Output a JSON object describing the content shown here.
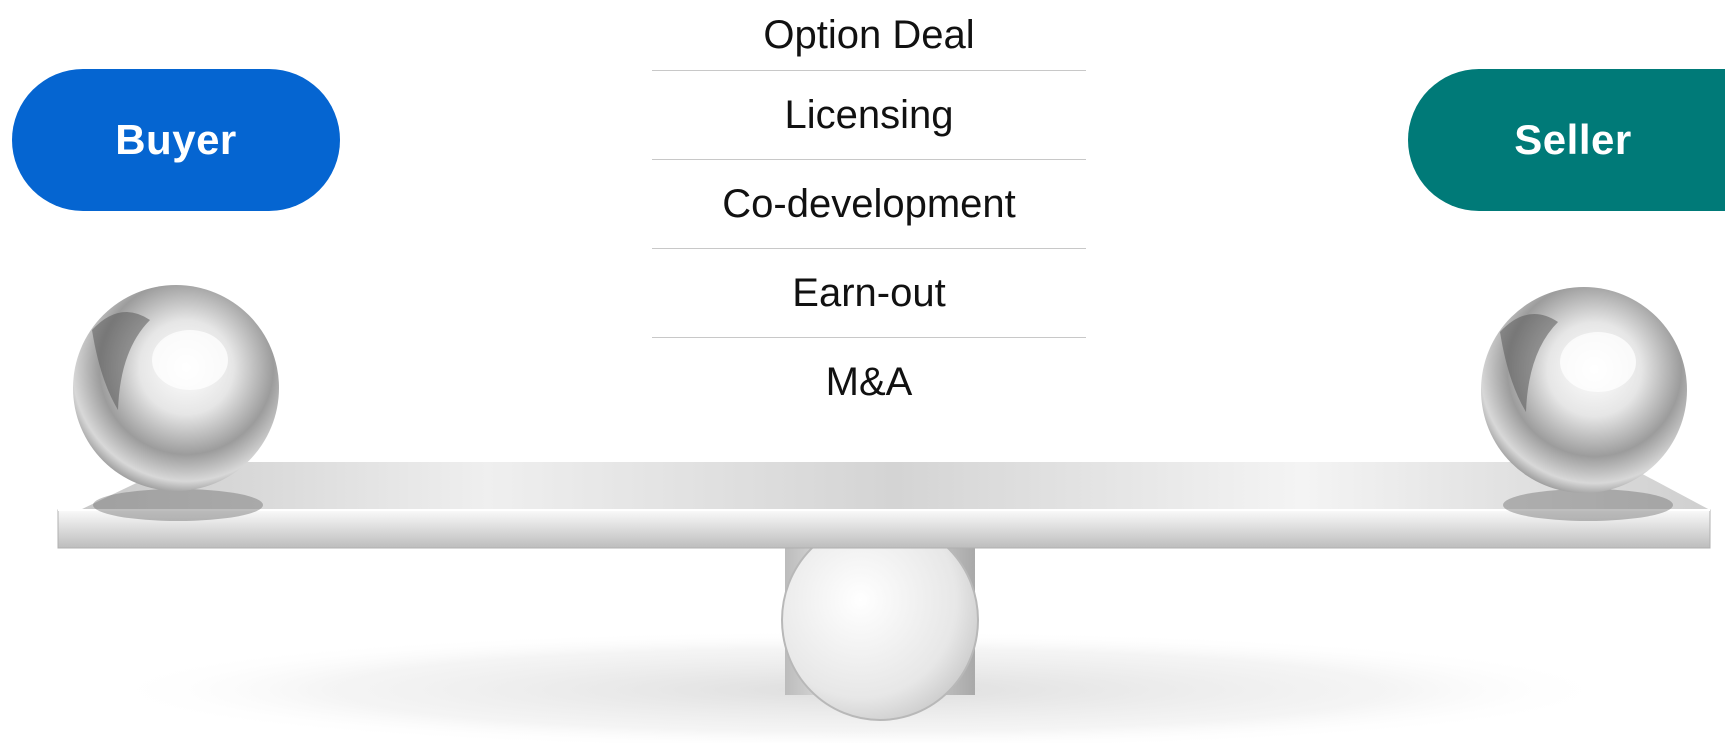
{
  "parties": {
    "buyer": {
      "label": "Buyer",
      "color": "#0565d1"
    },
    "seller": {
      "label": "Seller",
      "color": "#007a78"
    }
  },
  "deal_options": [
    "Option Deal",
    "Licensing",
    "Co-development",
    "Earn-out",
    "M&A"
  ],
  "illustration": "balance-scale-with-two-chrome-balls"
}
